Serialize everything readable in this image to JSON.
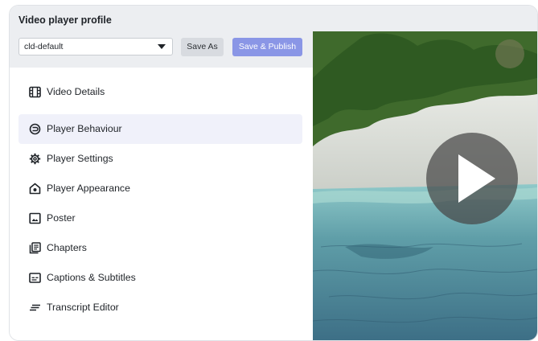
{
  "panel": {
    "title": "Video player profile",
    "profile_select": {
      "value": "cld-default"
    },
    "save_as_label": "Save As",
    "save_publish_label": "Save & Publish"
  },
  "menu": {
    "items": [
      {
        "label": "Video Details",
        "icon": "film-icon",
        "active": false
      },
      {
        "label": "Player Behaviour",
        "icon": "player-behaviour-icon",
        "active": true
      },
      {
        "label": "Player Settings",
        "icon": "gear-icon",
        "active": false
      },
      {
        "label": "Player Appearance",
        "icon": "appearance-icon",
        "active": false
      },
      {
        "label": "Poster",
        "icon": "image-icon",
        "active": false
      },
      {
        "label": "Chapters",
        "icon": "chapters-icon",
        "active": false
      },
      {
        "label": "Captions & Subtitles",
        "icon": "captions-icon",
        "active": false
      },
      {
        "label": "Transcript Editor",
        "icon": "transcript-icon",
        "active": false
      }
    ]
  },
  "colors": {
    "header_bg": "#eceef1",
    "active_item_bg": "#f0f1fa",
    "publish_button": "#8a96e6",
    "save_as_button": "#d8dbe0"
  },
  "video": {
    "play_icon": "play-icon"
  }
}
